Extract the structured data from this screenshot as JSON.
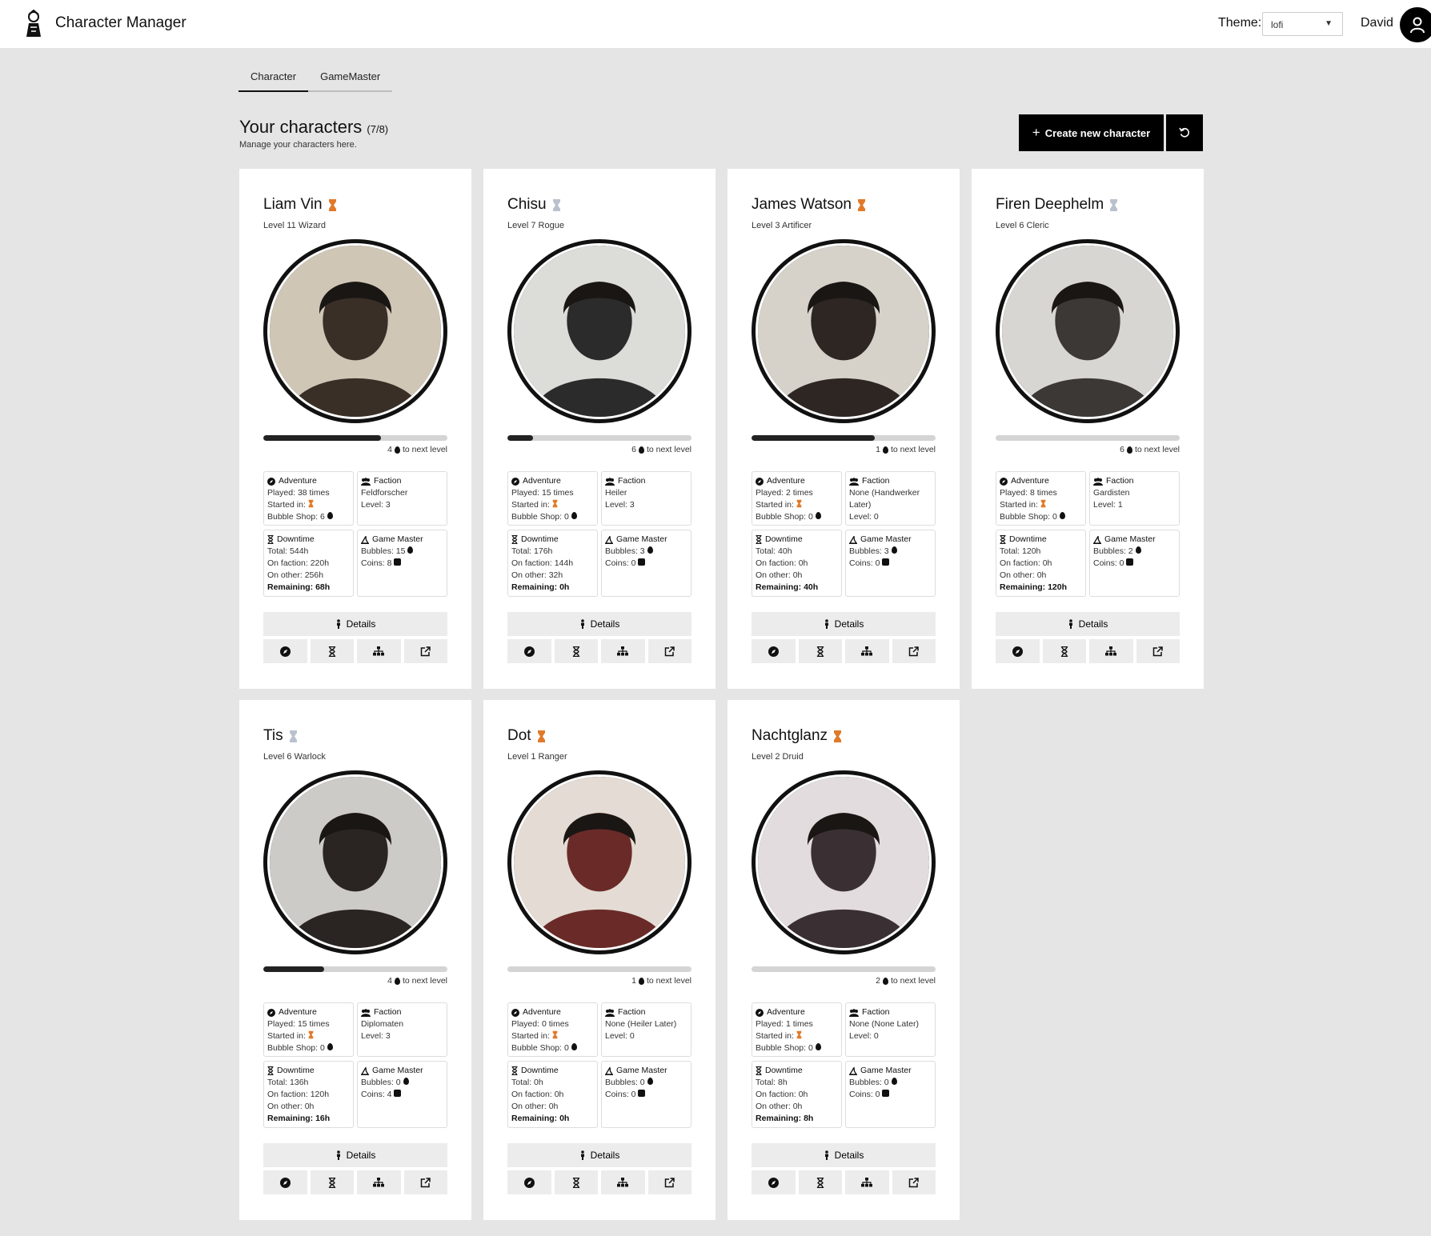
{
  "app": {
    "title": "Character Manager"
  },
  "header": {
    "theme_label": "Theme:",
    "theme_value": "lofi",
    "user_name": "David"
  },
  "tabs": [
    {
      "label": "Character",
      "active": true
    },
    {
      "label": "GameMaster",
      "active": false
    }
  ],
  "page": {
    "heading": "Your characters",
    "count": "(7/8)",
    "subheading": "Manage your characters here.",
    "create_label": "Create new character"
  },
  "labels": {
    "adventure": "Adventure",
    "faction": "Faction",
    "downtime": "Downtime",
    "game_master": "Game Master",
    "details": "Details",
    "to_next_level": "to next level"
  },
  "colors": {
    "tier_gold": "#e07a2a",
    "tier_silver": "#b9c2cc",
    "accent": "#000000"
  },
  "characters": [
    {
      "name": "Liam Vin",
      "tier": "gold",
      "level": "Level 11 Wizard",
      "progress": 0.64,
      "next": "4",
      "adv_played": "Played: 38 times",
      "adv_started": "Started in:",
      "adv_shop": "Bubble Shop: 6",
      "fac_name": "Feldforscher",
      "fac_level": "Level: 3",
      "dt_total": "Total: 544h",
      "dt_faction": "On faction: 220h",
      "dt_other": "On other: 256h",
      "dt_remaining": "Remaining: 68h",
      "gm_bubbles": "Bubbles: 15",
      "gm_coins": "Coins: 8",
      "portrait_bg": "#cfc6b6",
      "portrait_fg": "#3a2f27"
    },
    {
      "name": "Chisu",
      "tier": "silver",
      "level": "Level 7 Rogue",
      "progress": 0.14,
      "next": "6",
      "adv_played": "Played: 15 times",
      "adv_started": "Started in:",
      "adv_shop": "Bubble Shop: 0",
      "fac_name": "Heiler",
      "fac_level": "Level: 3",
      "dt_total": "Total: 176h",
      "dt_faction": "On faction: 144h",
      "dt_other": "On other: 32h",
      "dt_remaining": "Remaining: 0h",
      "gm_bubbles": "Bubbles: 3",
      "gm_coins": "Coins: 0",
      "portrait_bg": "#dcdcd8",
      "portrait_fg": "#2b2b2b"
    },
    {
      "name": "James Watson",
      "tier": "gold",
      "level": "Level 3 Artificer",
      "progress": 0.67,
      "next": "1",
      "adv_played": "Played: 2 times",
      "adv_started": "Started in:",
      "adv_shop": "Bubble Shop: 0",
      "fac_name": "None (Handwerker Later)",
      "fac_level": "Level: 0",
      "dt_total": "Total: 40h",
      "dt_faction": "On faction: 0h",
      "dt_other": "On other: 0h",
      "dt_remaining": "Remaining: 40h",
      "gm_bubbles": "Bubbles: 3",
      "gm_coins": "Coins: 0",
      "portrait_bg": "#d6d2ca",
      "portrait_fg": "#2d2622"
    },
    {
      "name": "Firen Deephelm",
      "tier": "silver",
      "level": "Level 6 Cleric",
      "progress": 0.0,
      "next": "6",
      "adv_played": "Played: 8 times",
      "adv_started": "Started in:",
      "adv_shop": "Bubble Shop: 0",
      "fac_name": "Gardisten",
      "fac_level": "Level: 1",
      "dt_total": "Total: 120h",
      "dt_faction": "On faction: 0h",
      "dt_other": "On other: 0h",
      "dt_remaining": "Remaining: 120h",
      "gm_bubbles": "Bubbles: 2",
      "gm_coins": "Coins: 0",
      "portrait_bg": "#d8d6d2",
      "portrait_fg": "#3b3835"
    },
    {
      "name": "Tis",
      "tier": "silver",
      "level": "Level 6 Warlock",
      "progress": 0.33,
      "next": "4",
      "adv_played": "Played: 15 times",
      "adv_started": "Started in:",
      "adv_shop": "Bubble Shop: 0",
      "fac_name": "Diplomaten",
      "fac_level": "Level: 3",
      "dt_total": "Total: 136h",
      "dt_faction": "On faction: 120h",
      "dt_other": "On other: 0h",
      "dt_remaining": "Remaining: 16h",
      "gm_bubbles": "Bubbles: 0",
      "gm_coins": "Coins: 4",
      "portrait_bg": "#cdcbc8",
      "portrait_fg": "#2a2523"
    },
    {
      "name": "Dot",
      "tier": "gold",
      "level": "Level 1 Ranger",
      "progress": 0.0,
      "next": "1",
      "adv_played": "Played: 0 times",
      "adv_started": "Started in:",
      "adv_shop": "Bubble Shop: 0",
      "fac_name": "None (Heiler Later)",
      "fac_level": "Level: 0",
      "dt_total": "Total: 0h",
      "dt_faction": "On faction: 0h",
      "dt_other": "On other: 0h",
      "dt_remaining": "Remaining: 0h",
      "gm_bubbles": "Bubbles: 0",
      "gm_coins": "Coins: 0",
      "portrait_bg": "#e4dcd4",
      "portrait_fg": "#6a2b28"
    },
    {
      "name": "Nachtglanz",
      "tier": "gold",
      "level": "Level 2 Druid",
      "progress": 0.0,
      "next": "2",
      "adv_played": "Played: 1 times",
      "adv_started": "Started in:",
      "adv_shop": "Bubble Shop: 0",
      "fac_name": "None (None Later)",
      "fac_level": "Level: 0",
      "dt_total": "Total: 8h",
      "dt_faction": "On faction: 0h",
      "dt_other": "On other: 0h",
      "dt_remaining": "Remaining: 8h",
      "gm_bubbles": "Bubbles: 0",
      "gm_coins": "Coins: 0",
      "portrait_bg": "#e2dcde",
      "portrait_fg": "#3a3033"
    }
  ]
}
